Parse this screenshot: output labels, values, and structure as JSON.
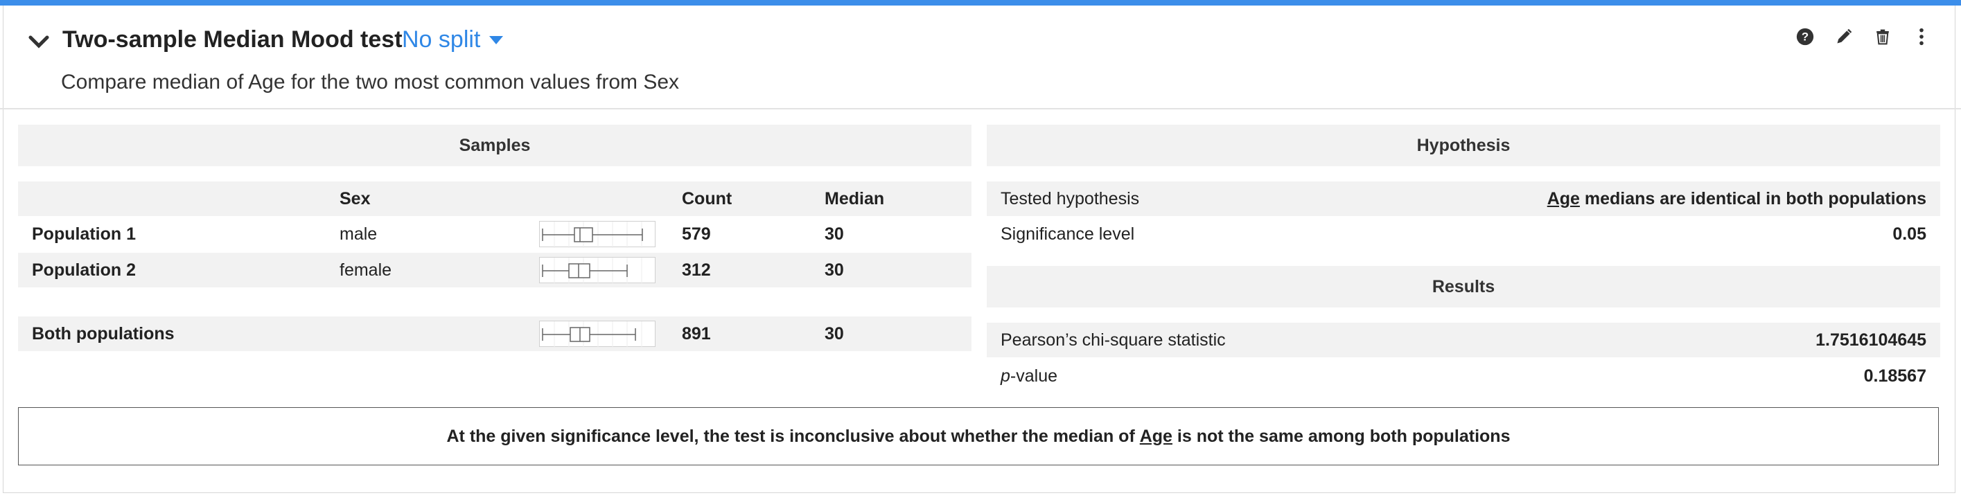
{
  "header": {
    "title": "Two-sample Median Mood test",
    "split_label": "No split",
    "subtitle": "Compare median of Age for the two most common values from Sex"
  },
  "samples": {
    "title": "Samples",
    "columns": {
      "group": "Sex",
      "count": "Count",
      "median": "Median"
    },
    "rows": [
      {
        "label": "Population 1",
        "group": "male",
        "count": "579",
        "median": "30"
      },
      {
        "label": "Population 2",
        "group": "female",
        "count": "312",
        "median": "30"
      },
      {
        "label": "Both populations",
        "group": "",
        "count": "891",
        "median": "30"
      }
    ]
  },
  "hypothesis": {
    "title": "Hypothesis",
    "tested_label": "Tested hypothesis",
    "tested_var": "Age",
    "tested_text": " medians are identical in both populations",
    "significance_label": "Significance level",
    "significance_value": "0.05"
  },
  "results": {
    "title": "Results",
    "chi_label": "Pearson’s chi-square statistic",
    "chi_value": "1.7516104645",
    "p_label_italic": "p",
    "p_label_rest": "-value",
    "p_value": "0.18567"
  },
  "conclusion": {
    "before": "At the given significance level, the test is inconclusive about whether the median of ",
    "var": "Age",
    "after": " is not the same among both populations"
  },
  "colors": {
    "accent": "#3c8eea",
    "link": "#2f87e6",
    "shade": "#f2f2f2"
  },
  "icons": [
    "chevron-down-icon",
    "caret-down-icon",
    "help-icon",
    "pencil-icon",
    "trash-icon",
    "more-vertical-icon"
  ]
}
